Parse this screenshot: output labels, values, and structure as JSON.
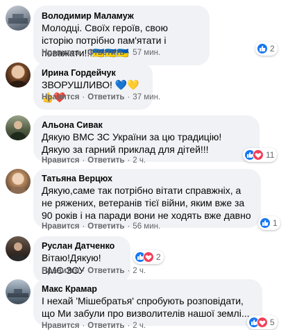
{
  "comments": [
    {
      "author": "Володимир Маламуж",
      "text": "Молодці. Своїх героїв, свою історію потрібно пам'ятати і поважати!!!🇺🇦🇺🇦🇺🇦",
      "like": "Нравится",
      "reply": "Ответить",
      "time": "57 мин.",
      "reactions": "2"
    },
    {
      "author": "Ирина Гордейчук",
      "text": "ЗВОРУШЛИВО! 💙💛👍❤️",
      "like": "Нравится",
      "reply": "Ответить",
      "time": "37 мин."
    },
    {
      "author": "Альона Сивак",
      "text": "Дякую ВМС ЗС України за цю традицію! Дякую за гарний приклад для дітей!!!",
      "like": "Нравится",
      "reply": "Ответить",
      "time": "2 ч.",
      "reactions": "11"
    },
    {
      "author": "Татьяна Верцюх",
      "text": "Дякую,саме так потрібно вітати справжніх, а не ряжених, ветеранів тієї війни, яким вже за 90 років і на паради вони не ходять вже давно",
      "like": "Нравится",
      "reply": "Ответить",
      "time": "56 мин.",
      "reactions": "1"
    },
    {
      "author": "Руслан Датченко",
      "text": "Вітаю!Дякую!ВМС ЗСУ",
      "like": "Нравится",
      "reply": "Ответить",
      "time": "2 ч.",
      "reactions": "2"
    },
    {
      "author": "Макс Крамар",
      "text": "І нехай 'Мішебратья' спробують розповідати, що Ми забули про визволителів нашої землі...",
      "like": "Нравится",
      "reply": "Ответить",
      "time": "2 ч.",
      "reactions": "5"
    }
  ],
  "colors": {
    "bubble": "#f0f2f5",
    "like_blue": "#1877f2",
    "love_red": "#f33e58",
    "meta_gray": "#65676b"
  }
}
